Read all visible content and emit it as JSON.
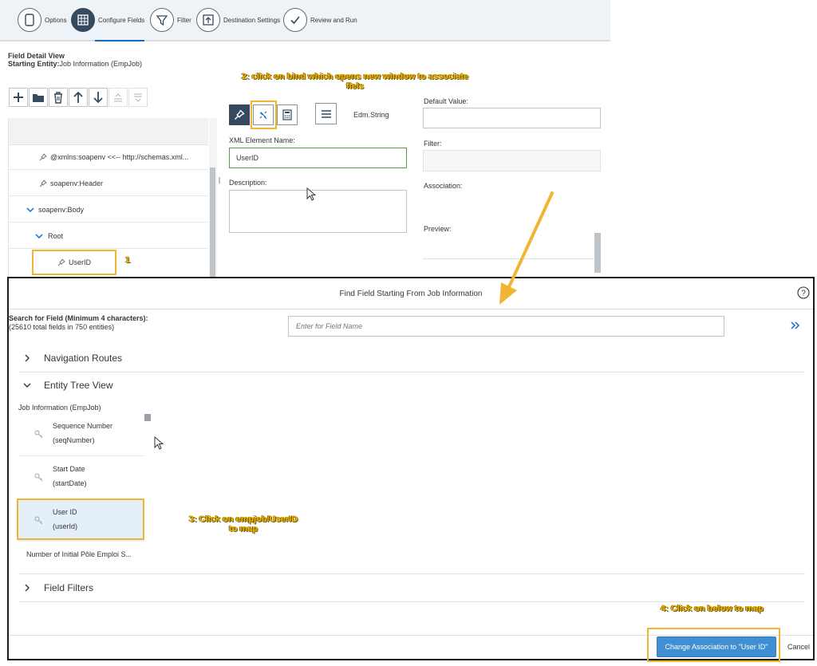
{
  "wizard": {
    "steps": [
      {
        "label": "Options"
      },
      {
        "label": "Configure Fields"
      },
      {
        "label": "Filter"
      },
      {
        "label": "Destination Settings"
      },
      {
        "label": "Review and Run"
      }
    ],
    "active_step": "Configure Fields"
  },
  "field_detail": {
    "title": "Field Detail View",
    "starting_entity_label": "Starting Entity:",
    "starting_entity_value": "Job Information (EmpJob)"
  },
  "tree": {
    "rows": [
      {
        "label": "@xmlns:soapenv <<-- http://schemas.xml...",
        "icon": "pin-icon"
      },
      {
        "label": "soapenv:Header",
        "icon": "pin-icon"
      },
      {
        "label": "soapenv:Body",
        "icon": "chevron-down-icon"
      },
      {
        "label": "Root",
        "icon": "chevron-down-icon"
      },
      {
        "label": "UserID",
        "icon": "pin-icon"
      }
    ]
  },
  "detail": {
    "type_label": "Edm.String",
    "xml_element_name_label": "XML Element Name:",
    "xml_element_name_value": "UserID",
    "description_label": "Description:",
    "default_value_label": "Default Value:",
    "filter_label": "Filter:",
    "association_label": "Association:",
    "preview_label": "Preview:"
  },
  "annotations": {
    "a1": "1",
    "a2_line1": "2: click on bind which opens new window to associate",
    "a2_line2": "fiels",
    "a3_line1": "3: Click on  empjob/UserID",
    "a3_line2": "to map",
    "a4": "4: Click on below to map"
  },
  "dialog": {
    "title": "Find Field Starting From Job Information",
    "search_label": "Search for Field (Minimum 4 characters):",
    "search_sub": "(25610 total fields in 750 entities)",
    "search_placeholder": "Enter for Field Name",
    "sections": {
      "navigation_routes": "Navigation Routes",
      "entity_tree_view": "Entity Tree View",
      "field_filters": "Field Filters"
    },
    "entity_root": "Job Information (EmpJob)",
    "fields": [
      {
        "name": "Sequence Number",
        "code": "(seqNumber)"
      },
      {
        "name": "Start Date",
        "code": "(startDate)"
      },
      {
        "name": "User ID",
        "code": "(userId)"
      }
    ],
    "truncated_field": "Number of Initial Pôle Emploi S...",
    "primary_button": "Change Association to \"User ID\"",
    "cancel_button": "Cancel"
  },
  "colors": {
    "accent_dark": "#354a5f",
    "annotation": "#f4b400",
    "primary_button": "#3f8fd2",
    "selected_row": "#e5eff8"
  }
}
